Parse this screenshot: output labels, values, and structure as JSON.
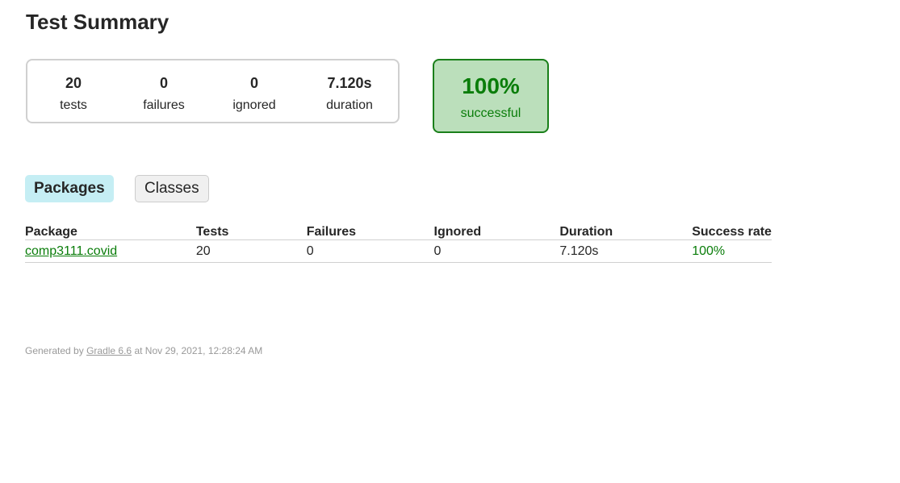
{
  "page": {
    "title": "Test Summary"
  },
  "summary": {
    "tests": {
      "value": "20",
      "label": "tests"
    },
    "failures": {
      "value": "0",
      "label": "failures"
    },
    "ignored": {
      "value": "0",
      "label": "ignored"
    },
    "duration": {
      "value": "7.120s",
      "label": "duration"
    }
  },
  "success": {
    "percent": "100%",
    "label": "successful"
  },
  "tabs": [
    {
      "label": "Packages",
      "active": true
    },
    {
      "label": "Classes",
      "active": false
    }
  ],
  "table": {
    "headers": [
      "Package",
      "Tests",
      "Failures",
      "Ignored",
      "Duration",
      "Success rate"
    ],
    "rows": [
      {
        "package": "comp3111.covid",
        "tests": "20",
        "failures": "0",
        "ignored": "0",
        "duration": "7.120s",
        "success_rate": "100%"
      }
    ]
  },
  "footer": {
    "prefix": "Generated by ",
    "link_text": "Gradle 6.6",
    "suffix": " at Nov 29, 2021, 12:28:24 AM"
  },
  "colors": {
    "success_green": "#0a7d0a",
    "success_bg": "#bbdfbb",
    "active_tab_bg": "#c5eef4",
    "inactive_tab_bg": "#f0f0f0"
  }
}
